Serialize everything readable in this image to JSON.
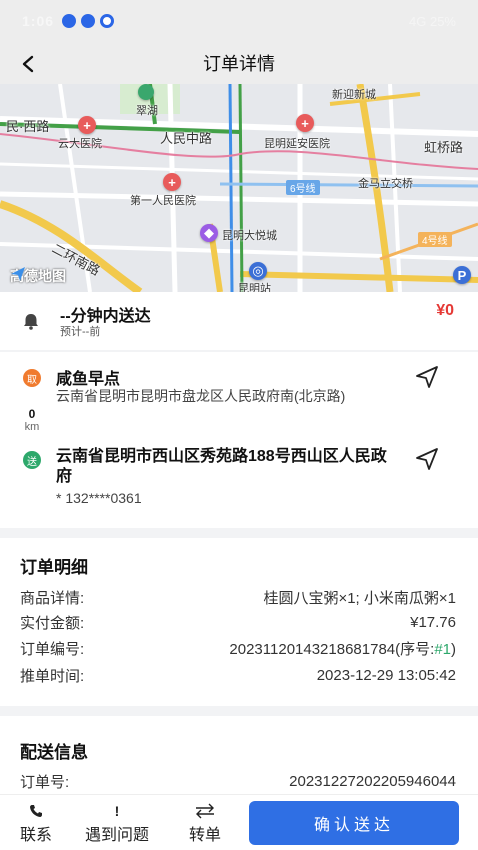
{
  "status_bar": {
    "time": "1:06",
    "right_text": "4G 25%"
  },
  "header": {
    "title": "订单详情",
    "back_icon": "chevron-left-icon"
  },
  "map": {
    "labels": {
      "xinying": "新迎新城",
      "cuihu": "翠湖",
      "minxi": "民·西路",
      "yunda": "云大医院",
      "renmin": "人民中路",
      "yanan": "昆明延安医院",
      "hongqiao": "虹桥路",
      "line6": "6号线",
      "jinma": "金马立交桥",
      "diyi": "第一人民医院",
      "dayuecheng": "昆明大悦城",
      "erhuan": "二环南路",
      "line4": "4号线",
      "station": "昆明站",
      "watermark": "高德地图"
    }
  },
  "eta": {
    "title": "--分钟内送达",
    "subtitle": "预计--前",
    "price": "¥0"
  },
  "route": {
    "pickup_tag": "取",
    "pickup_name": "咸鱼早点",
    "pickup_address": "云南省昆明市昆明市盘龙区人民政府南(北京路)",
    "distance_value": "0",
    "distance_unit": "km",
    "delivery_tag": "送",
    "delivery_address": "云南省昆明市西山区秀苑路188号西山区人民政府",
    "phone": "* 132****0361"
  },
  "order_detail": {
    "title": "订单明细",
    "rows": [
      {
        "label": "商品详情:",
        "value": "桂圆八宝粥×1; 小米南瓜粥×1"
      },
      {
        "label": "实付金额:",
        "value": "¥17.76"
      },
      {
        "label": "订单编号:",
        "value_prefix": "20231120143218681784(序号:",
        "value_highlight": "#1",
        "value_suffix": ")"
      },
      {
        "label": "推单时间:",
        "value": "2023-12-29 13:05:42"
      }
    ]
  },
  "delivery_info": {
    "title": "配送信息",
    "order_no_label": "订单号:",
    "order_no_value": "20231227202205946044"
  },
  "bottom_bar": {
    "contact": "联系",
    "problem": "遇到问题",
    "transfer": "转单",
    "confirm": "确认送达"
  },
  "colors": {
    "accent": "#2f6fe4",
    "price": "#e53935",
    "pickup": "#f07b2f",
    "delivery": "#2da86b"
  }
}
